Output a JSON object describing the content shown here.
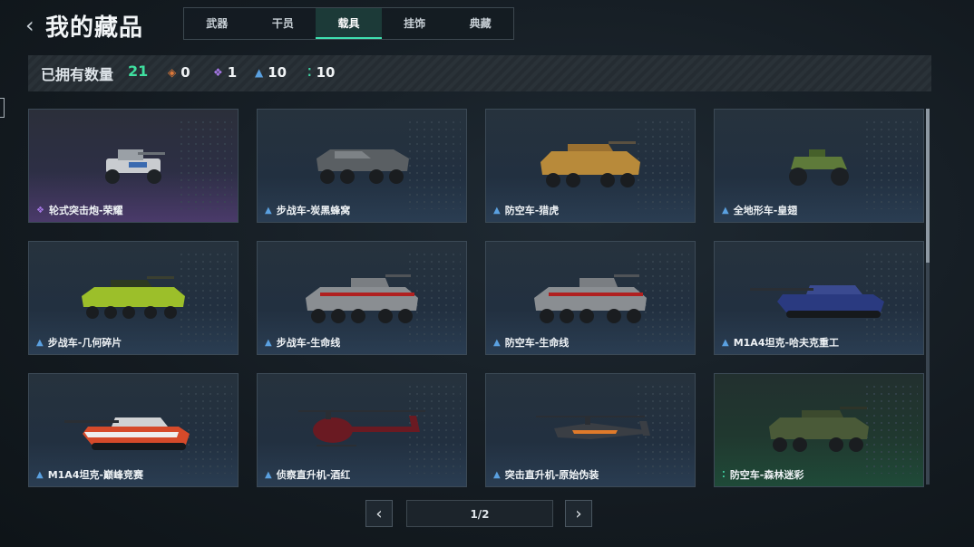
{
  "header": {
    "title": "我的藏品",
    "back_icon": "chevron-left-icon"
  },
  "tabs": [
    {
      "label": "武器",
      "active": false
    },
    {
      "label": "干员",
      "active": false
    },
    {
      "label": "载具",
      "active": true
    },
    {
      "label": "挂饰",
      "active": false
    },
    {
      "label": "典藏",
      "active": false
    }
  ],
  "counts": {
    "owned_label": "已拥有数量",
    "owned_value": "21",
    "rarity": [
      {
        "icon": "orange-diamond-icon",
        "color": "#e07a3a",
        "value": "0"
      },
      {
        "icon": "purple-diamond-icon",
        "color": "#a678e6",
        "value": "1"
      },
      {
        "icon": "blue-triangles-icon",
        "color": "#5aa0e0",
        "value": "10"
      },
      {
        "icon": "green-dots-icon",
        "color": "#3fd0a0",
        "value": "10"
      }
    ]
  },
  "items": [
    {
      "name": "轮式突击炮-荣耀",
      "rarity": "purple",
      "vehicle": "buggy"
    },
    {
      "name": "步战车-炭黑蜂窝",
      "rarity": "blue",
      "vehicle": "apc"
    },
    {
      "name": "防空车-猎虎",
      "rarity": "blue",
      "vehicle": "apc"
    },
    {
      "name": "全地形车-皇翅",
      "rarity": "blue",
      "vehicle": "atv"
    },
    {
      "name": "步战车-几何碎片",
      "rarity": "blue",
      "vehicle": "apc"
    },
    {
      "name": "步战车-生命线",
      "rarity": "blue",
      "vehicle": "apc"
    },
    {
      "name": "防空车-生命线",
      "rarity": "blue",
      "vehicle": "apc"
    },
    {
      "name": "M1A4坦克-哈夫克重工",
      "rarity": "blue",
      "vehicle": "tank"
    },
    {
      "name": "M1A4坦克-巅峰竞赛",
      "rarity": "blue",
      "vehicle": "tank"
    },
    {
      "name": "侦察直升机-酒红",
      "rarity": "blue",
      "vehicle": "heli"
    },
    {
      "name": "突击直升机-原始伪装",
      "rarity": "blue",
      "vehicle": "attack-heli"
    },
    {
      "name": "防空车-森林迷彩",
      "rarity": "green",
      "vehicle": "apc"
    }
  ],
  "pager": {
    "text": "1/2",
    "prev_icon": "chevron-left-icon",
    "next_icon": "chevron-right-icon"
  }
}
